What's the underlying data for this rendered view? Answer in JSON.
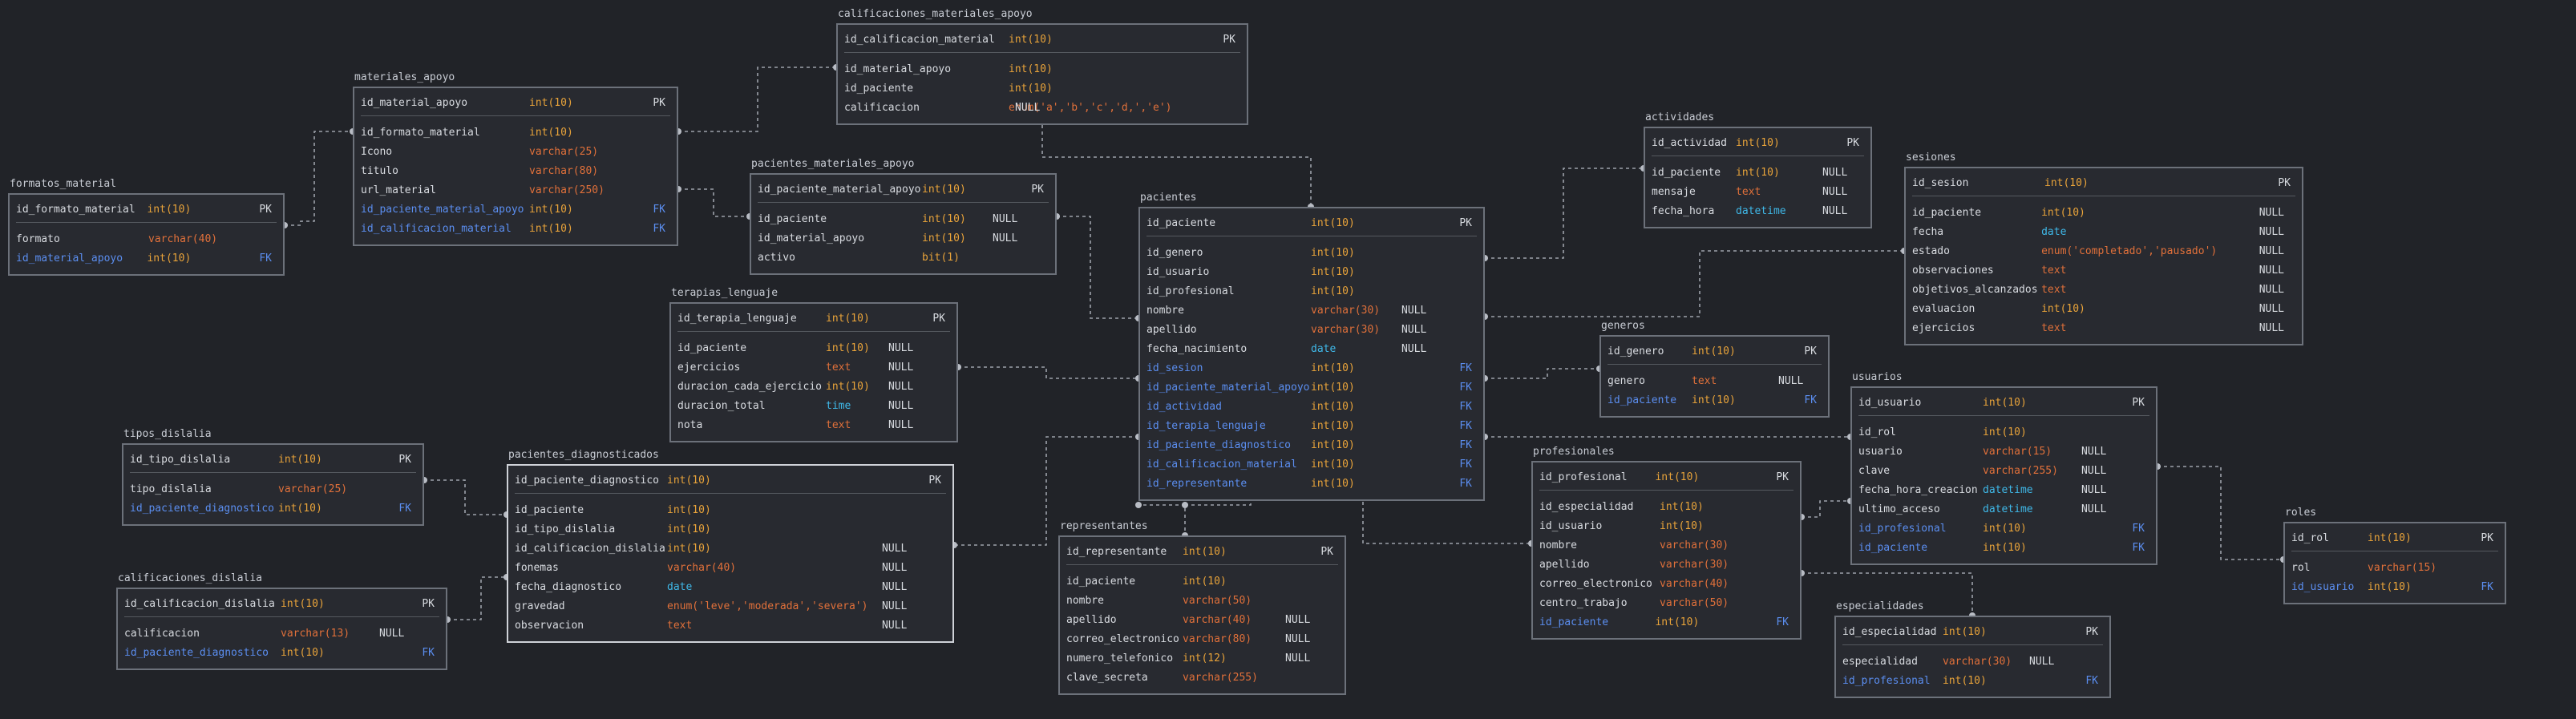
{
  "colors": {
    "background": "#212328",
    "table_border": "#6c717a",
    "table_border_selected": "#cfd2d8",
    "table_fill": "#282a30",
    "text": "#d8dbe0",
    "fk": "#5b8ef0",
    "int": "#e8a33a",
    "varchar": "#e0703a",
    "text_type": "#e0703a",
    "date": "#3fb8e8",
    "time": "#3fb8e8",
    "datetime": "#3fb8e8",
    "enum": "#e0703a",
    "bit": "#e8a33a",
    "connector": "#9da2aa"
  },
  "tables": [
    {
      "name": "formatos_material",
      "rows": [
        {
          "col": "id_formato_material",
          "type": "int(10)",
          "null": "",
          "key": "PK"
        },
        {
          "col": "formato",
          "type": "varchar(40)",
          "null": "",
          "key": ""
        },
        {
          "col": "id_material_apoyo",
          "type": "int(10)",
          "null": "",
          "key": "FK"
        }
      ]
    },
    {
      "name": "materiales_apoyo",
      "rows": [
        {
          "col": "id_material_apoyo",
          "type": "int(10)",
          "null": "",
          "key": "PK"
        },
        {
          "col": "id_formato_material",
          "type": "int(10)",
          "null": "",
          "key": ""
        },
        {
          "col": "Icono",
          "type": "varchar(25)",
          "null": "",
          "key": ""
        },
        {
          "col": "titulo",
          "type": "varchar(80)",
          "null": "",
          "key": ""
        },
        {
          "col": "url_material",
          "type": "varchar(250)",
          "null": "",
          "key": ""
        },
        {
          "col": "id_paciente_material_apoyo",
          "type": "int(10)",
          "null": "",
          "key": "FK"
        },
        {
          "col": "id_calificacion_material",
          "type": "int(10)",
          "null": "",
          "key": "FK"
        }
      ]
    },
    {
      "name": "calificaciones_materiales_apoyo",
      "rows": [
        {
          "col": "id_calificacion_material",
          "type": "int(10)",
          "null": "",
          "key": "PK"
        },
        {
          "col": "id_material_apoyo",
          "type": "int(10)",
          "null": "",
          "key": ""
        },
        {
          "col": "id_paciente",
          "type": "int(10)",
          "null": "",
          "key": ""
        },
        {
          "col": "calificacion",
          "type": "enum('a','b','c','d,','e')",
          "null": "NULL",
          "key": ""
        }
      ]
    },
    {
      "name": "pacientes_materiales_apoyo",
      "rows": [
        {
          "col": "id_paciente_material_apoyo",
          "type": "int(10)",
          "null": "",
          "key": "PK"
        },
        {
          "col": "id_paciente",
          "type": "int(10)",
          "null": "NULL",
          "key": ""
        },
        {
          "col": "id_material_apoyo",
          "type": "int(10)",
          "null": "NULL",
          "key": ""
        },
        {
          "col": "activo",
          "type": "bit(1)",
          "null": "",
          "key": ""
        }
      ]
    },
    {
      "name": "terapias_lenguaje",
      "rows": [
        {
          "col": "id_terapia_lenguaje",
          "type": "int(10)",
          "null": "",
          "key": "PK"
        },
        {
          "col": "id_paciente",
          "type": "int(10)",
          "null": "NULL",
          "key": ""
        },
        {
          "col": "ejercicios",
          "type": "text",
          "null": "NULL",
          "key": ""
        },
        {
          "col": "duracion_cada_ejercicio",
          "type": "int(10)",
          "null": "NULL",
          "key": ""
        },
        {
          "col": "duracion_total",
          "type": "time",
          "null": "NULL",
          "key": ""
        },
        {
          "col": "nota",
          "type": "text",
          "null": "NULL",
          "key": ""
        }
      ]
    },
    {
      "name": "pacientes",
      "rows": [
        {
          "col": "id_paciente",
          "type": "int(10)",
          "null": "",
          "key": "PK"
        },
        {
          "col": "id_genero",
          "type": "int(10)",
          "null": "",
          "key": ""
        },
        {
          "col": "id_usuario",
          "type": "int(10)",
          "null": "",
          "key": ""
        },
        {
          "col": "id_profesional",
          "type": "int(10)",
          "null": "",
          "key": ""
        },
        {
          "col": "nombre",
          "type": "varchar(30)",
          "null": "NULL",
          "key": ""
        },
        {
          "col": "apellido",
          "type": "varchar(30)",
          "null": "NULL",
          "key": ""
        },
        {
          "col": "fecha_nacimiento",
          "type": "date",
          "null": "NULL",
          "key": ""
        },
        {
          "col": "id_sesion",
          "type": "int(10)",
          "null": "",
          "key": "FK"
        },
        {
          "col": "id_paciente_material_apoyo",
          "type": "int(10)",
          "null": "",
          "key": "FK"
        },
        {
          "col": "id_actividad",
          "type": "int(10)",
          "null": "",
          "key": "FK"
        },
        {
          "col": "id_terapia_lenguaje",
          "type": "int(10)",
          "null": "",
          "key": "FK"
        },
        {
          "col": "id_paciente_diagnostico",
          "type": "int(10)",
          "null": "",
          "key": "FK"
        },
        {
          "col": "id_calificacion_material",
          "type": "int(10)",
          "null": "",
          "key": "FK"
        },
        {
          "col": "id_representante",
          "type": "int(10)",
          "null": "",
          "key": "FK"
        }
      ]
    },
    {
      "name": "actividades",
      "rows": [
        {
          "col": "id_actividad",
          "type": "int(10)",
          "null": "",
          "key": "PK"
        },
        {
          "col": "id_paciente",
          "type": "int(10)",
          "null": "NULL",
          "key": ""
        },
        {
          "col": "mensaje",
          "type": "text",
          "null": "NULL",
          "key": ""
        },
        {
          "col": "fecha_hora",
          "type": "datetime",
          "null": "NULL",
          "key": ""
        }
      ]
    },
    {
      "name": "sesiones",
      "rows": [
        {
          "col": "id_sesion",
          "type": "int(10)",
          "null": "",
          "key": "PK"
        },
        {
          "col": "id_paciente",
          "type": "int(10)",
          "null": "NULL",
          "key": ""
        },
        {
          "col": "fecha",
          "type": "date",
          "null": "NULL",
          "key": ""
        },
        {
          "col": "estado",
          "type": "enum('completado','pausado')",
          "null": "NULL",
          "key": ""
        },
        {
          "col": "observaciones",
          "type": "text",
          "null": "NULL",
          "key": ""
        },
        {
          "col": "objetivos_alcanzados",
          "type": "text",
          "null": "NULL",
          "key": ""
        },
        {
          "col": "evaluacion",
          "type": "int(10)",
          "null": "NULL",
          "key": ""
        },
        {
          "col": "ejercicios",
          "type": "text",
          "null": "NULL",
          "key": ""
        }
      ]
    },
    {
      "name": "generos",
      "rows": [
        {
          "col": "id_genero",
          "type": "int(10)",
          "null": "",
          "key": "PK"
        },
        {
          "col": "genero",
          "type": "text",
          "null": "NULL",
          "key": ""
        },
        {
          "col": "id_paciente",
          "type": "int(10)",
          "null": "",
          "key": "FK"
        }
      ]
    },
    {
      "name": "usuarios",
      "rows": [
        {
          "col": "id_usuario",
          "type": "int(10)",
          "null": "",
          "key": "PK"
        },
        {
          "col": "id_rol",
          "type": "int(10)",
          "null": "",
          "key": ""
        },
        {
          "col": "usuario",
          "type": "varchar(15)",
          "null": "NULL",
          "key": ""
        },
        {
          "col": "clave",
          "type": "varchar(255)",
          "null": "NULL",
          "key": ""
        },
        {
          "col": "fecha_hora_creacion",
          "type": "datetime",
          "null": "NULL",
          "key": ""
        },
        {
          "col": "ultimo_acceso",
          "type": "datetime",
          "null": "NULL",
          "key": ""
        },
        {
          "col": "id_profesional",
          "type": "int(10)",
          "null": "",
          "key": "FK"
        },
        {
          "col": "id_paciente",
          "type": "int(10)",
          "null": "",
          "key": "FK"
        }
      ]
    },
    {
      "name": "roles",
      "rows": [
        {
          "col": "id_rol",
          "type": "int(10)",
          "null": "",
          "key": "PK"
        },
        {
          "col": "rol",
          "type": "varchar(15)",
          "null": "",
          "key": ""
        },
        {
          "col": "id_usuario",
          "type": "int(10)",
          "null": "",
          "key": "FK"
        }
      ]
    },
    {
      "name": "tipos_dislalia",
      "rows": [
        {
          "col": "id_tipo_dislalia",
          "type": "int(10)",
          "null": "",
          "key": "PK"
        },
        {
          "col": "tipo_dislalia",
          "type": "varchar(25)",
          "null": "",
          "key": ""
        },
        {
          "col": "id_paciente_diagnostico",
          "type": "int(10)",
          "null": "",
          "key": "FK"
        }
      ]
    },
    {
      "name": "pacientes_diagnosticados",
      "rows": [
        {
          "col": "id_paciente_diagnostico",
          "type": "int(10)",
          "null": "",
          "key": "PK"
        },
        {
          "col": "id_paciente",
          "type": "int(10)",
          "null": "",
          "key": ""
        },
        {
          "col": "id_tipo_dislalia",
          "type": "int(10)",
          "null": "",
          "key": ""
        },
        {
          "col": "id_calificacion_dislalia",
          "type": "int(10)",
          "null": "NULL",
          "key": ""
        },
        {
          "col": "fonemas",
          "type": "varchar(40)",
          "null": "NULL",
          "key": ""
        },
        {
          "col": "fecha_diagnostico",
          "type": "date",
          "null": "NULL",
          "key": ""
        },
        {
          "col": "gravedad",
          "type": "enum('leve','moderada','severa')",
          "null": "NULL",
          "key": ""
        },
        {
          "col": "observacion",
          "type": "text",
          "null": "NULL",
          "key": ""
        }
      ]
    },
    {
      "name": "calificaciones_dislalia",
      "rows": [
        {
          "col": "id_calificacion_dislalia",
          "type": "int(10)",
          "null": "",
          "key": "PK"
        },
        {
          "col": "calificacion",
          "type": "varchar(13)",
          "null": "NULL",
          "key": ""
        },
        {
          "col": "id_paciente_diagnostico",
          "type": "int(10)",
          "null": "",
          "key": "FK"
        }
      ]
    },
    {
      "name": "representantes",
      "rows": [
        {
          "col": "id_representante",
          "type": "int(10)",
          "null": "",
          "key": "PK"
        },
        {
          "col": "id_paciente",
          "type": "int(10)",
          "null": "",
          "key": ""
        },
        {
          "col": "nombre",
          "type": "varchar(50)",
          "null": "",
          "key": ""
        },
        {
          "col": "apellido",
          "type": "varchar(40)",
          "null": "NULL",
          "key": ""
        },
        {
          "col": "correo_electronico",
          "type": "varchar(80)",
          "null": "NULL",
          "key": ""
        },
        {
          "col": "numero_telefonico",
          "type": "int(12)",
          "null": "NULL",
          "key": ""
        },
        {
          "col": "clave_secreta",
          "type": "varchar(255)",
          "null": "",
          "key": ""
        }
      ]
    },
    {
      "name": "profesionales",
      "rows": [
        {
          "col": "id_profesional",
          "type": "int(10)",
          "null": "",
          "key": "PK"
        },
        {
          "col": "id_especialidad",
          "type": "int(10)",
          "null": "",
          "key": ""
        },
        {
          "col": "id_usuario",
          "type": "int(10)",
          "null": "",
          "key": ""
        },
        {
          "col": "nombre",
          "type": "varchar(30)",
          "null": "",
          "key": ""
        },
        {
          "col": "apellido",
          "type": "varchar(30)",
          "null": "",
          "key": ""
        },
        {
          "col": "correo_electronico",
          "type": "varchar(40)",
          "null": "",
          "key": ""
        },
        {
          "col": "centro_trabajo",
          "type": "varchar(50)",
          "null": "",
          "key": ""
        },
        {
          "col": "id_paciente",
          "type": "int(10)",
          "null": "",
          "key": "FK"
        }
      ]
    },
    {
      "name": "especialidades",
      "rows": [
        {
          "col": "id_especialidad",
          "type": "int(10)",
          "null": "",
          "key": "PK"
        },
        {
          "col": "especialidad",
          "type": "varchar(30)",
          "null": "NULL",
          "key": ""
        },
        {
          "col": "id_profesional",
          "type": "int(10)",
          "null": "",
          "key": "FK"
        }
      ]
    }
  ]
}
